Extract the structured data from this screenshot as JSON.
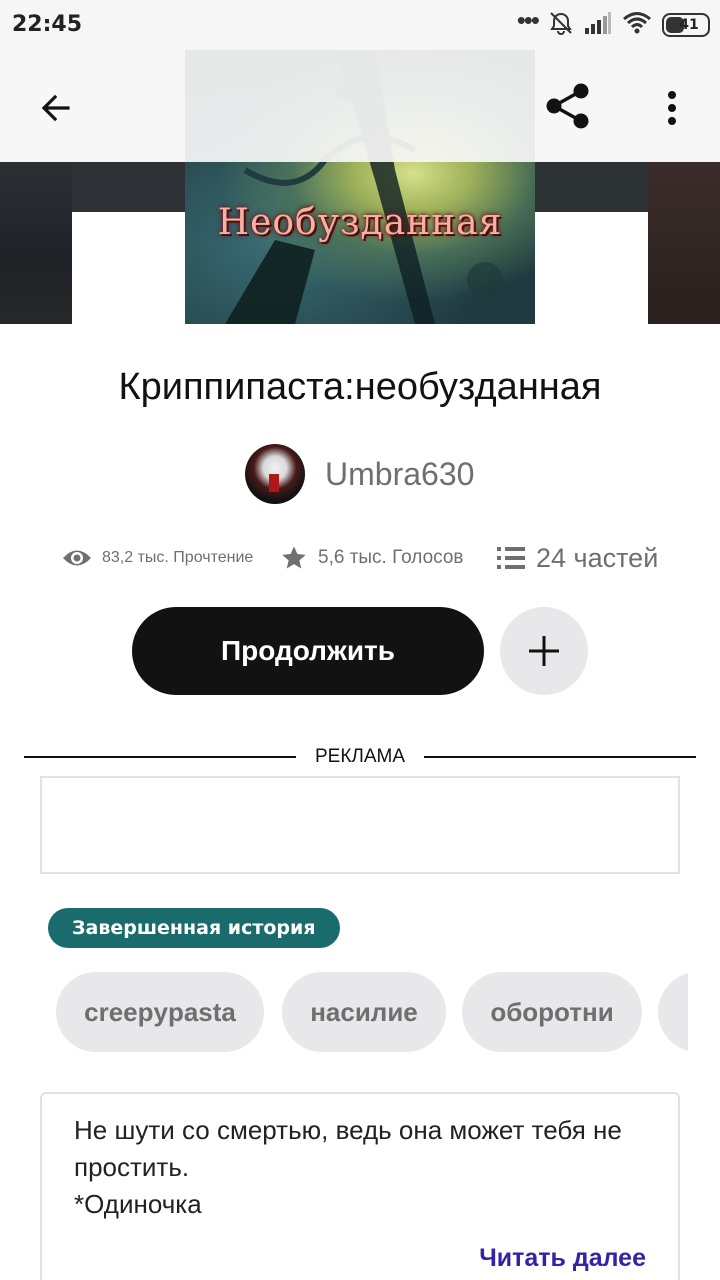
{
  "status_bar": {
    "time": "22:45",
    "battery": "41",
    "icons": [
      "more-dots-icon",
      "alarm-off-icon",
      "signal-icon",
      "wifi-icon",
      "battery-icon"
    ]
  },
  "toolbar": {
    "icons": [
      "back-arrow-icon",
      "share-icon",
      "more-vertical-icon"
    ]
  },
  "cover": {
    "title_text": "Необузданная"
  },
  "story": {
    "title": "Криппипаста:необузданная",
    "author": "Umbra630"
  },
  "stats": {
    "reads": "83,2 тыс. Прочтение",
    "votes": "5,6 тыс. Голосов",
    "parts": "24 частей"
  },
  "actions": {
    "continue_label": "Продолжить"
  },
  "ad": {
    "label": "РЕКЛАМА"
  },
  "badge": {
    "completed": "Завершенная история"
  },
  "tags": [
    "creepypasta",
    "насилие",
    "оборотни"
  ],
  "description": {
    "text": "Не шути со смертью, ведь она может тебя не простить.\n*Одиночка",
    "read_more": "Читать далее"
  },
  "colors": {
    "primary_button": "#121212",
    "badge": "#1a6b6b",
    "link": "#3323a6",
    "muted_text": "#6f6f6f",
    "chip_bg": "#e8e8ea"
  }
}
